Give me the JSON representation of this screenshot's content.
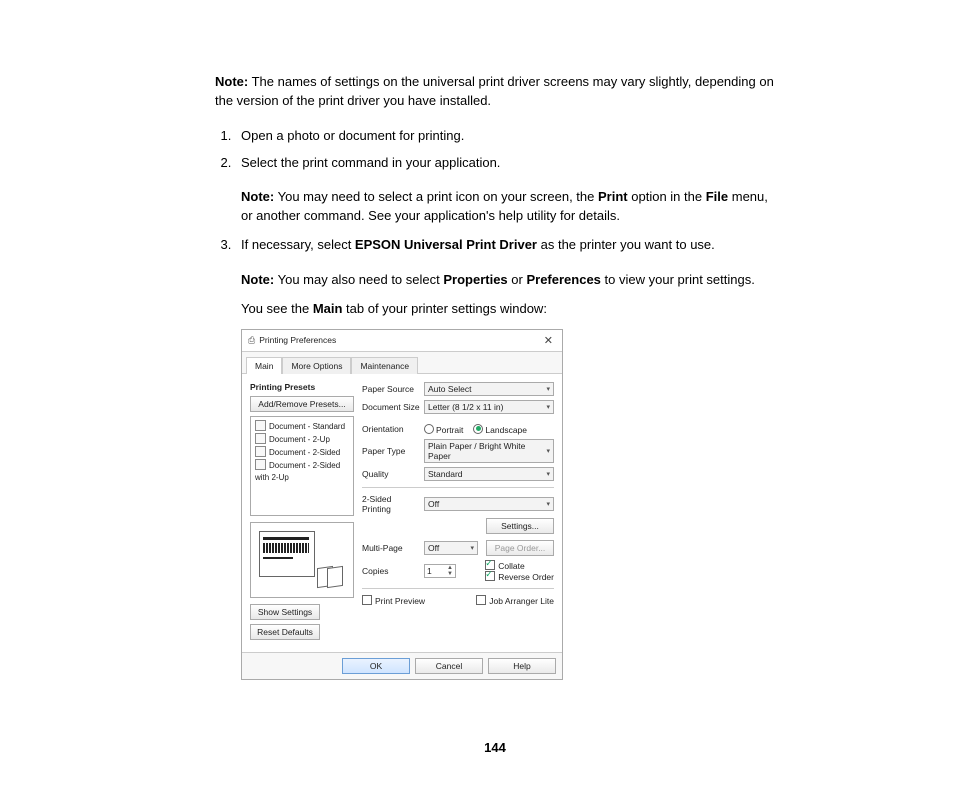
{
  "doc": {
    "note1": "The names of settings on the universal print driver screens may vary slightly, depending on the version of the print driver you have installed.",
    "note_label": "Note:",
    "steps": {
      "s1": "Open a photo or document for printing.",
      "s2": "Select the print command in your application.",
      "s3_pre": "If necessary, select ",
      "s3_bold": "EPSON Universal Print Driver",
      "s3_post": " as the printer you want to use."
    },
    "subnote2_a": "You may need to select a print icon on your screen, the ",
    "subnote2_b": " option in the ",
    "subnote2_c": " menu, or another command. See your application's help utility for details.",
    "print_word": "Print",
    "file_word": "File",
    "subnote3_a": "You may also need to select ",
    "properties": "Properties",
    "or_word": " or ",
    "preferences": "Preferences",
    "subnote3_b": " to view your print settings.",
    "see_a": "You see the ",
    "main_word": "Main",
    "see_b": " tab of your printer settings window:",
    "page_number": "144"
  },
  "dialog": {
    "title": "Printing Preferences",
    "tabs": {
      "main": "Main",
      "more": "More Options",
      "maint": "Maintenance"
    },
    "left": {
      "heading": "Printing Presets",
      "add_remove": "Add/Remove Presets...",
      "presets": {
        "p1": "Document - Standard",
        "p2": "Document - 2-Up",
        "p3": "Document - 2-Sided",
        "p4": "Document - 2-Sided with 2-Up"
      },
      "show_settings": "Show Settings",
      "reset_defaults": "Reset Defaults"
    },
    "right": {
      "paper_source_lbl": "Paper Source",
      "paper_source_val": "Auto Select",
      "doc_size_lbl": "Document Size",
      "doc_size_val": "Letter (8 1/2 x 11 in)",
      "orientation_lbl": "Orientation",
      "portrait": "Portrait",
      "landscape": "Landscape",
      "paper_type_lbl": "Paper Type",
      "paper_type_val": "Plain Paper / Bright White Paper",
      "quality_lbl": "Quality",
      "quality_val": "Standard",
      "twosided_lbl": "2-Sided Printing",
      "twosided_val": "Off",
      "settings_btn": "Settings...",
      "multipage_lbl": "Multi-Page",
      "multipage_val": "Off",
      "pageorder_btn": "Page Order...",
      "copies_lbl": "Copies",
      "copies_val": "1",
      "collate": "Collate",
      "reverse": "Reverse Order",
      "print_preview": "Print Preview",
      "job_arranger": "Job Arranger Lite"
    },
    "footer": {
      "ok": "OK",
      "cancel": "Cancel",
      "help": "Help"
    }
  }
}
